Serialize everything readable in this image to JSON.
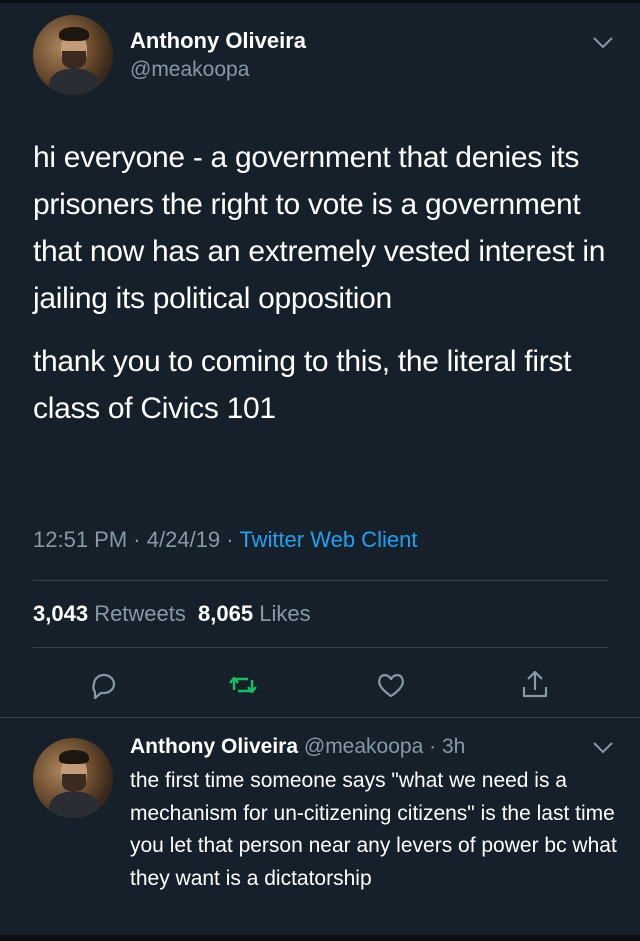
{
  "tweet": {
    "author_name": "Anthony Oliveira",
    "author_handle": "@meakoopa",
    "paragraphs": [
      "hi everyone - a government that denies its prisoners the right to vote is a government that now has an extremely vested interest in jailing its political opposition",
      "thank you to coming to this, the literal first class of Civics 101"
    ],
    "time": "12:51 PM",
    "date": "4/24/19",
    "client": "Twitter Web Client",
    "retweets_count": "3,043",
    "retweets_label": "Retweets",
    "likes_count": "8,065",
    "likes_label": "Likes"
  },
  "reply": {
    "author_name": "Anthony Oliveira",
    "author_handle": "@meakoopa",
    "age": "3h",
    "text": "the first time someone says \"what we need is a mechanism for un-citizening citizens\" is the last time you let that person near any levers of power bc what they want is a dictatorship"
  },
  "icons": [
    "chevron-down-icon",
    "reply-icon",
    "retweet-icon",
    "like-icon",
    "share-icon"
  ],
  "colors": {
    "background": "#15202b",
    "secondary_text": "#8899a6",
    "link": "#1da1f2",
    "retweet_green": "#17bf63",
    "divider": "#38444d"
  }
}
